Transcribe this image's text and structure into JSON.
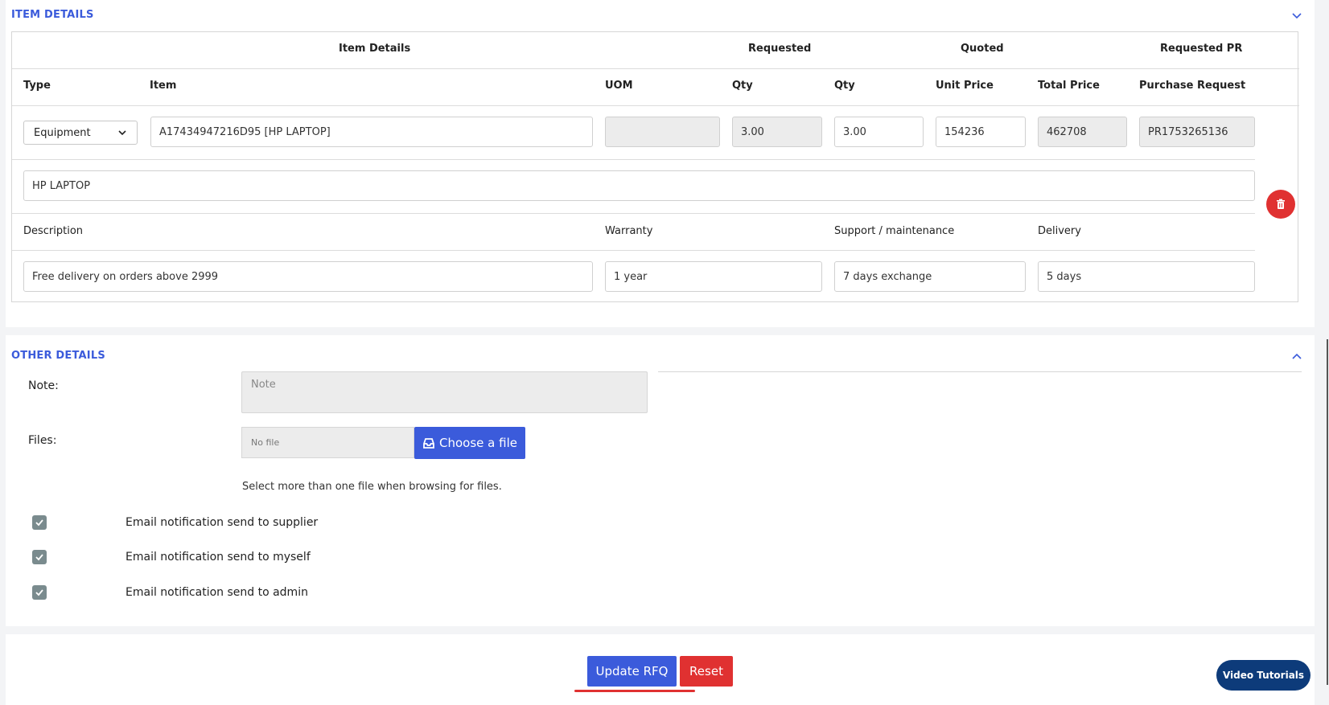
{
  "item_details": {
    "title": "ITEM DETAILS",
    "group_headers": {
      "item_details": "Item Details",
      "requested": "Requested",
      "quoted": "Quoted",
      "requested_pr": "Requested PR"
    },
    "columns": {
      "type": "Type",
      "item": "Item",
      "uom": "UOM",
      "req_qty": "Qty",
      "quoted_qty": "Qty",
      "unit_price": "Unit Price",
      "total_price": "Total Price",
      "purchase_request": "Purchase Request"
    },
    "row": {
      "type_value": "Equipment",
      "item_value": "A17434947216D95 [HP LAPTOP]",
      "uom_value": "",
      "req_qty_value": "3.00",
      "quoted_qty_value": "3.00",
      "unit_price_value": "154236",
      "total_price_value": "462708",
      "purchase_request_value": "PR1753265136",
      "name_value": "HP LAPTOP"
    },
    "sub_columns": {
      "description": "Description",
      "warranty": "Warranty",
      "support": "Support / maintenance",
      "delivery": "Delivery"
    },
    "sub_row": {
      "description_value": "Free delivery on orders above 2999",
      "warranty_value": "1 year",
      "support_value": "7 days exchange",
      "delivery_value": "5 days"
    }
  },
  "other_details": {
    "title": "OTHER DETAILS",
    "note_label": "Note:",
    "note_placeholder": "Note",
    "files_label": "Files:",
    "file_status": "No file",
    "choose_file": "Choose a file",
    "hint": "Select more than one file when browsing for files.",
    "checkboxes": [
      "Email notification send to supplier",
      "Email notification send to myself",
      "Email notification send to admin"
    ]
  },
  "actions": {
    "update": "Update RFQ",
    "reset": "Reset",
    "video": "Video Tutorials"
  },
  "colors": {
    "accent": "#3b5bdb",
    "danger": "#e03131",
    "video": "#0d3b7a"
  }
}
